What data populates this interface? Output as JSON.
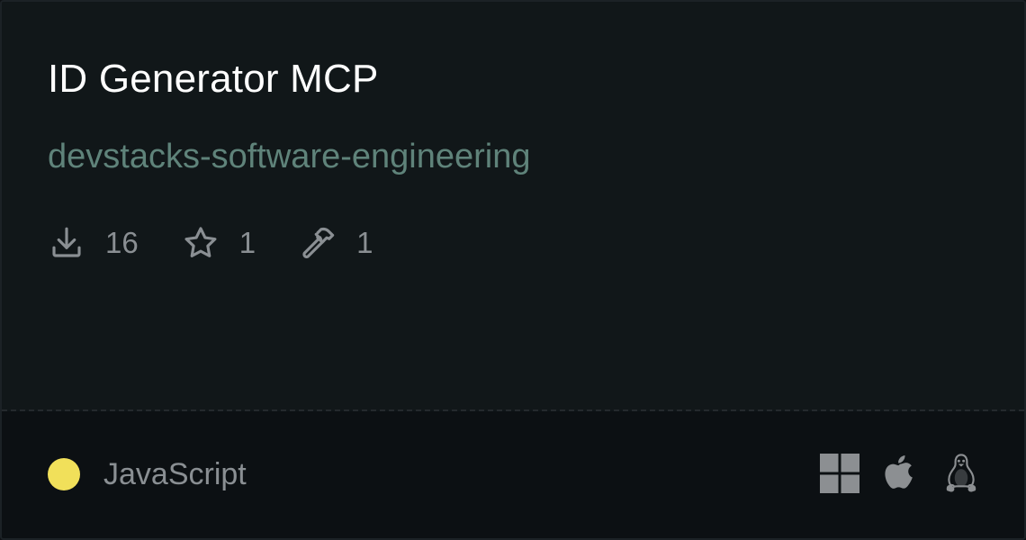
{
  "card": {
    "title": "ID Generator MCP",
    "author": "devstacks-software-engineering",
    "stats": {
      "downloads": {
        "icon": "download-icon",
        "value": "16"
      },
      "stars": {
        "icon": "star-icon",
        "value": "1"
      },
      "tools": {
        "icon": "hammer-icon",
        "value": "1"
      }
    },
    "language": {
      "name": "JavaScript",
      "color": "#f1e05a"
    },
    "platforms": [
      "windows-icon",
      "apple-icon",
      "linux-icon"
    ]
  },
  "colors": {
    "title": "#ffffff",
    "author": "#5f837a",
    "muted": "#8a8f93",
    "platform_icon": "#8c8f92"
  }
}
